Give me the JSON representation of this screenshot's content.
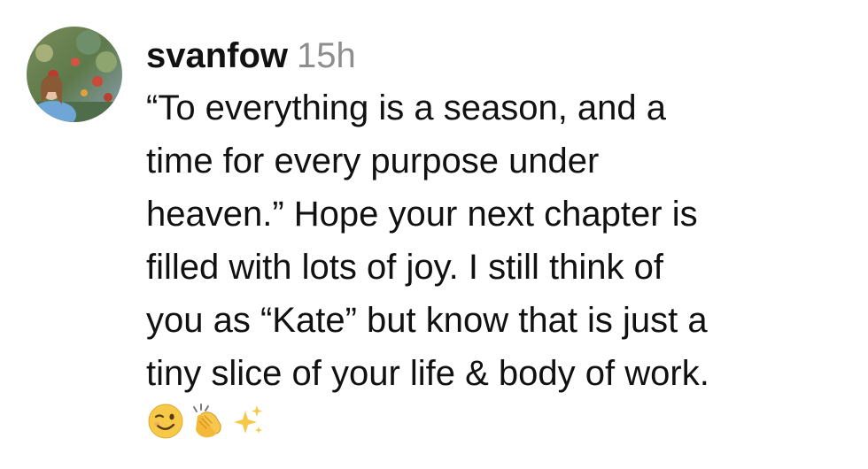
{
  "comment": {
    "username": "svanfow",
    "timestamp": "15h",
    "lines": [
      "“To everything is a season, and a",
      "time for every purpose under",
      "heaven.” Hope your next chapter is",
      "filled with lots of joy. I still think of",
      "you as “Kate” but know that is just a",
      "tiny slice of your life & body of work."
    ],
    "emojis": [
      "winking-face",
      "clapping-hands",
      "sparkles"
    ]
  }
}
